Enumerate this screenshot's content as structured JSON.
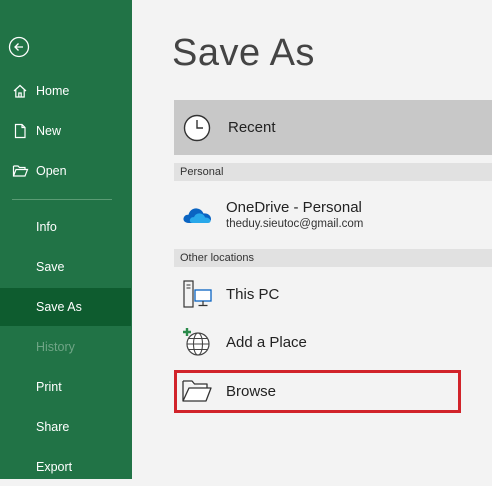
{
  "sidebar": {
    "items": [
      {
        "label": "Home",
        "icon": "home-icon"
      },
      {
        "label": "New",
        "icon": "new-document-icon"
      },
      {
        "label": "Open",
        "icon": "open-folder-icon"
      },
      {
        "label": "Info"
      },
      {
        "label": "Save"
      },
      {
        "label": "Save As",
        "active": true
      },
      {
        "label": "History",
        "disabled": true
      },
      {
        "label": "Print"
      },
      {
        "label": "Share"
      },
      {
        "label": "Export"
      }
    ]
  },
  "main": {
    "title": "Save As",
    "recent_label": "Recent",
    "personal_header": "Personal",
    "onedrive_name": "OneDrive - Personal",
    "onedrive_email": "theduy.sieutoc@gmail.com",
    "other_header": "Other locations",
    "this_pc_label": "This PC",
    "add_place_label": "Add a Place",
    "browse_label": "Browse"
  },
  "colors": {
    "sidebar_bg": "#217346",
    "sidebar_active": "#0e5c2f",
    "highlight_border": "#d1232a",
    "onedrive_blue": "#0a64c2"
  }
}
